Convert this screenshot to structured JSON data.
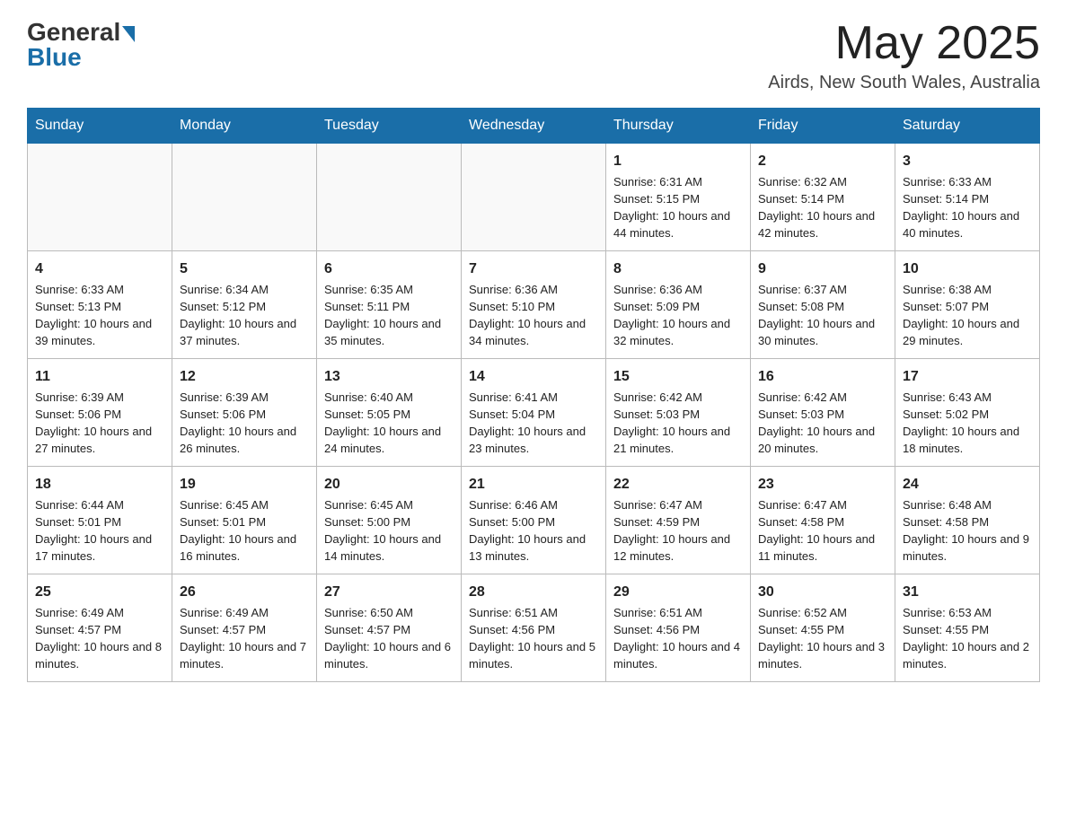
{
  "logo": {
    "general": "General",
    "blue": "Blue"
  },
  "title": "May 2025",
  "location": "Airds, New South Wales, Australia",
  "days_of_week": [
    "Sunday",
    "Monday",
    "Tuesday",
    "Wednesday",
    "Thursday",
    "Friday",
    "Saturday"
  ],
  "weeks": [
    [
      {
        "day": "",
        "info": ""
      },
      {
        "day": "",
        "info": ""
      },
      {
        "day": "",
        "info": ""
      },
      {
        "day": "",
        "info": ""
      },
      {
        "day": "1",
        "info": "Sunrise: 6:31 AM\nSunset: 5:15 PM\nDaylight: 10 hours and 44 minutes."
      },
      {
        "day": "2",
        "info": "Sunrise: 6:32 AM\nSunset: 5:14 PM\nDaylight: 10 hours and 42 minutes."
      },
      {
        "day": "3",
        "info": "Sunrise: 6:33 AM\nSunset: 5:14 PM\nDaylight: 10 hours and 40 minutes."
      }
    ],
    [
      {
        "day": "4",
        "info": "Sunrise: 6:33 AM\nSunset: 5:13 PM\nDaylight: 10 hours and 39 minutes."
      },
      {
        "day": "5",
        "info": "Sunrise: 6:34 AM\nSunset: 5:12 PM\nDaylight: 10 hours and 37 minutes."
      },
      {
        "day": "6",
        "info": "Sunrise: 6:35 AM\nSunset: 5:11 PM\nDaylight: 10 hours and 35 minutes."
      },
      {
        "day": "7",
        "info": "Sunrise: 6:36 AM\nSunset: 5:10 PM\nDaylight: 10 hours and 34 minutes."
      },
      {
        "day": "8",
        "info": "Sunrise: 6:36 AM\nSunset: 5:09 PM\nDaylight: 10 hours and 32 minutes."
      },
      {
        "day": "9",
        "info": "Sunrise: 6:37 AM\nSunset: 5:08 PM\nDaylight: 10 hours and 30 minutes."
      },
      {
        "day": "10",
        "info": "Sunrise: 6:38 AM\nSunset: 5:07 PM\nDaylight: 10 hours and 29 minutes."
      }
    ],
    [
      {
        "day": "11",
        "info": "Sunrise: 6:39 AM\nSunset: 5:06 PM\nDaylight: 10 hours and 27 minutes."
      },
      {
        "day": "12",
        "info": "Sunrise: 6:39 AM\nSunset: 5:06 PM\nDaylight: 10 hours and 26 minutes."
      },
      {
        "day": "13",
        "info": "Sunrise: 6:40 AM\nSunset: 5:05 PM\nDaylight: 10 hours and 24 minutes."
      },
      {
        "day": "14",
        "info": "Sunrise: 6:41 AM\nSunset: 5:04 PM\nDaylight: 10 hours and 23 minutes."
      },
      {
        "day": "15",
        "info": "Sunrise: 6:42 AM\nSunset: 5:03 PM\nDaylight: 10 hours and 21 minutes."
      },
      {
        "day": "16",
        "info": "Sunrise: 6:42 AM\nSunset: 5:03 PM\nDaylight: 10 hours and 20 minutes."
      },
      {
        "day": "17",
        "info": "Sunrise: 6:43 AM\nSunset: 5:02 PM\nDaylight: 10 hours and 18 minutes."
      }
    ],
    [
      {
        "day": "18",
        "info": "Sunrise: 6:44 AM\nSunset: 5:01 PM\nDaylight: 10 hours and 17 minutes."
      },
      {
        "day": "19",
        "info": "Sunrise: 6:45 AM\nSunset: 5:01 PM\nDaylight: 10 hours and 16 minutes."
      },
      {
        "day": "20",
        "info": "Sunrise: 6:45 AM\nSunset: 5:00 PM\nDaylight: 10 hours and 14 minutes."
      },
      {
        "day": "21",
        "info": "Sunrise: 6:46 AM\nSunset: 5:00 PM\nDaylight: 10 hours and 13 minutes."
      },
      {
        "day": "22",
        "info": "Sunrise: 6:47 AM\nSunset: 4:59 PM\nDaylight: 10 hours and 12 minutes."
      },
      {
        "day": "23",
        "info": "Sunrise: 6:47 AM\nSunset: 4:58 PM\nDaylight: 10 hours and 11 minutes."
      },
      {
        "day": "24",
        "info": "Sunrise: 6:48 AM\nSunset: 4:58 PM\nDaylight: 10 hours and 9 minutes."
      }
    ],
    [
      {
        "day": "25",
        "info": "Sunrise: 6:49 AM\nSunset: 4:57 PM\nDaylight: 10 hours and 8 minutes."
      },
      {
        "day": "26",
        "info": "Sunrise: 6:49 AM\nSunset: 4:57 PM\nDaylight: 10 hours and 7 minutes."
      },
      {
        "day": "27",
        "info": "Sunrise: 6:50 AM\nSunset: 4:57 PM\nDaylight: 10 hours and 6 minutes."
      },
      {
        "day": "28",
        "info": "Sunrise: 6:51 AM\nSunset: 4:56 PM\nDaylight: 10 hours and 5 minutes."
      },
      {
        "day": "29",
        "info": "Sunrise: 6:51 AM\nSunset: 4:56 PM\nDaylight: 10 hours and 4 minutes."
      },
      {
        "day": "30",
        "info": "Sunrise: 6:52 AM\nSunset: 4:55 PM\nDaylight: 10 hours and 3 minutes."
      },
      {
        "day": "31",
        "info": "Sunrise: 6:53 AM\nSunset: 4:55 PM\nDaylight: 10 hours and 2 minutes."
      }
    ]
  ]
}
